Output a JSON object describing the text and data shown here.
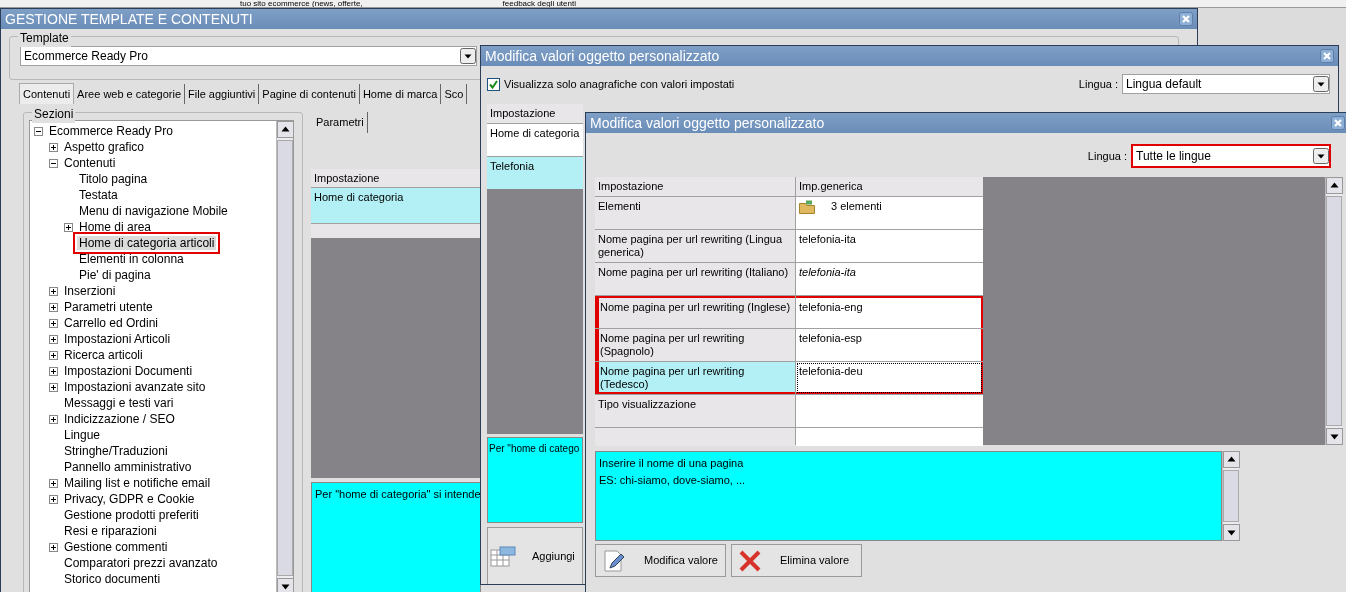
{
  "background_window": {
    "texts": [
      "tuo sito ecommerce (news, offerte,",
      "feedback degli utenti"
    ]
  },
  "main_window": {
    "title": "GESTIONE TEMPLATE E CONTENUTI",
    "template": {
      "label": "Template",
      "value": "Ecommerce Ready Pro"
    },
    "tabs": [
      {
        "label": "Contenuti",
        "selected": true
      },
      {
        "label": "Aree web e categorie",
        "selected": false
      },
      {
        "label": "File aggiuntivi",
        "selected": false
      },
      {
        "label": "Pagine di contenuti",
        "selected": false
      },
      {
        "label": "Home di marca",
        "selected": false
      },
      {
        "label": "Sco",
        "selected": false
      }
    ],
    "sections": {
      "label": "Sezioni",
      "tree": [
        {
          "label": "Ecommerce Ready Pro",
          "expanded": true,
          "selected": false,
          "highlighted": false,
          "children": [
            {
              "label": "Aspetto grafico",
              "expanded": false,
              "selected": false,
              "highlighted": false
            },
            {
              "label": "Contenuti",
              "expanded": true,
              "selected": false,
              "highlighted": false,
              "children": [
                {
                  "label": "Titolo pagina",
                  "selected": false,
                  "highlighted": false
                },
                {
                  "label": "Testata",
                  "selected": false,
                  "highlighted": false
                },
                {
                  "label": "Menu di navigazione Mobile",
                  "selected": false,
                  "highlighted": false
                },
                {
                  "label": "Home di area",
                  "expanded": false,
                  "selected": false,
                  "highlighted": false
                },
                {
                  "label": "Home di categoria articoli",
                  "selected": true,
                  "highlighted": true
                },
                {
                  "label": "Elementi in colonna",
                  "selected": false,
                  "highlighted": false
                },
                {
                  "label": "Pie' di pagina",
                  "selected": false,
                  "highlighted": false
                }
              ]
            },
            {
              "label": "Inserzioni",
              "expanded": false,
              "selected": false,
              "highlighted": false
            },
            {
              "label": "Parametri utente",
              "expanded": false,
              "selected": false,
              "highlighted": false
            },
            {
              "label": "Carrello ed Ordini",
              "expanded": false,
              "selected": false,
              "highlighted": false
            },
            {
              "label": "Impostazioni Articoli",
              "expanded": false,
              "selected": false,
              "highlighted": false
            },
            {
              "label": "Ricerca articoli",
              "expanded": false,
              "selected": false,
              "highlighted": false
            },
            {
              "label": "Impostazioni Documenti",
              "expanded": false,
              "selected": false,
              "highlighted": false
            },
            {
              "label": "Impostazioni avanzate sito",
              "expanded": false,
              "selected": false,
              "highlighted": false
            },
            {
              "label": "Messaggi e testi vari",
              "selected": false,
              "highlighted": false
            },
            {
              "label": "Indicizzazione / SEO",
              "expanded": false,
              "selected": false,
              "highlighted": false
            },
            {
              "label": "Lingue",
              "selected": false,
              "highlighted": false
            },
            {
              "label": "Stringhe/Traduzioni",
              "selected": false,
              "highlighted": false
            },
            {
              "label": "Pannello amministrativo",
              "selected": false,
              "highlighted": false
            },
            {
              "label": "Mailing list e notifiche email",
              "expanded": false,
              "selected": false,
              "highlighted": false
            },
            {
              "label": "Privacy, GDPR e Cookie",
              "expanded": false,
              "selected": false,
              "highlighted": false
            },
            {
              "label": "Gestione prodotti preferiti",
              "selected": false,
              "highlighted": false
            },
            {
              "label": "Resi e riparazioni",
              "selected": false,
              "highlighted": false
            },
            {
              "label": "Gestione commenti",
              "expanded": false,
              "selected": false,
              "highlighted": false
            },
            {
              "label": "Comparatori prezzi avanzato",
              "selected": false,
              "highlighted": false
            },
            {
              "label": "Storico documenti",
              "selected": false,
              "highlighted": false
            }
          ]
        }
      ]
    },
    "params": {
      "tab": "Parametri",
      "columns": [
        "Impostazione"
      ],
      "rows": [
        {
          "name": "Home di categoria",
          "selected": true
        }
      ],
      "description": "Per \"home di categoria\" si intende"
    }
  },
  "values_window": {
    "title": "Modifica valori oggetto personalizzato",
    "filter": {
      "label": "Visualizza solo anagrafiche con valori impostati",
      "checked": true
    },
    "language": {
      "label": "Lingua :",
      "value": "Lingua default",
      "highlighted": false
    },
    "columns": [
      "Impostazione"
    ],
    "rows": [
      {
        "name": "Home di categoria",
        "selected": false
      },
      {
        "name": "Telefonia",
        "selected": true
      }
    ],
    "description": "Per \"home di catego",
    "buttons": [
      {
        "label": "Aggiungi",
        "kind": "add"
      }
    ]
  },
  "edit_window": {
    "title": "Modifica valori oggetto personalizzato",
    "language": {
      "label": "Lingua :",
      "value": "Tutte le lingue",
      "highlighted": true
    },
    "columns": [
      "Impostazione",
      "Imp.generica"
    ],
    "rows": [
      {
        "name": "Elementi",
        "value": "3 elementi",
        "kind": "items",
        "inherited": false,
        "selected": false,
        "highlighted": false
      },
      {
        "name": "Nome pagina per url rewriting (Lingua generica)",
        "value": "telefonia-ita",
        "kind": "text",
        "inherited": false,
        "selected": false,
        "highlighted": false
      },
      {
        "name": "Nome pagina per url rewriting (Italiano)",
        "value": "telefonia-ita",
        "kind": "text",
        "inherited": true,
        "selected": false,
        "highlighted": false
      },
      {
        "name": "Nome pagina per url rewriting (Inglese)",
        "value": "telefonia-eng",
        "kind": "text",
        "inherited": false,
        "selected": false,
        "highlighted": true
      },
      {
        "name": "Nome pagina per url rewriting (Spagnolo)",
        "value": "telefonia-esp",
        "kind": "text",
        "inherited": false,
        "selected": false,
        "highlighted": true
      },
      {
        "name": "Nome pagina per url rewriting (Tedesco)",
        "value": "telefonia-deu",
        "kind": "text",
        "inherited": false,
        "selected": true,
        "highlighted": true
      },
      {
        "name": "Tipo visualizzazione",
        "kind": "text",
        "inherited": false,
        "selected": false,
        "highlighted": false
      }
    ],
    "description": [
      "Inserire il nome di una pagina",
      "ES: chi-siamo, dove-siamo, ..."
    ],
    "buttons": [
      {
        "label": "Modifica valore",
        "kind": "edit"
      },
      {
        "label": "Elimina valore",
        "kind": "delete"
      }
    ]
  }
}
